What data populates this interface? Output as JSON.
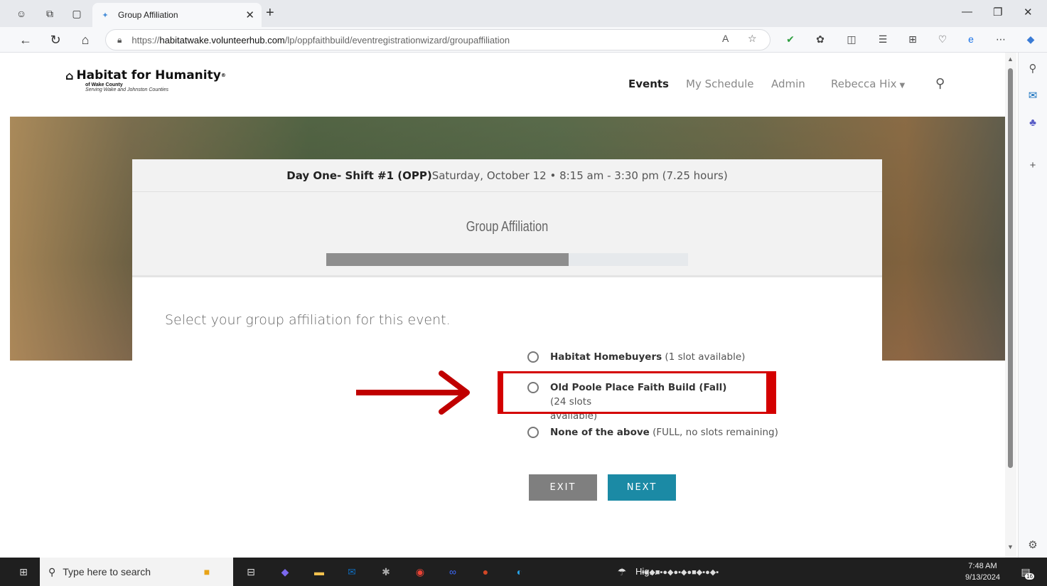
{
  "browser": {
    "tab_title": "Group Affiliation",
    "url_prefix": "https://",
    "url_domain": "habitatwake.volunteerhub.com",
    "url_path": "/lp/oppfaithbuild/eventregistrationwizard/groupaffiliation"
  },
  "site": {
    "logo_main": "Habitat for Humanity",
    "logo_reg": "®",
    "logo_sub1": "of Wake County",
    "logo_sub2": "Serving Wake and Johnston Counties",
    "nav": {
      "events": "Events",
      "my_schedule": "My Schedule",
      "admin": "Admin",
      "user": "Rebecca Hix"
    }
  },
  "event": {
    "name": "Day One- Shift #1 (OPP)",
    "datetime": "Saturday, October 12 • 8:15 am - 3:30 pm (7.25 hours)"
  },
  "wizard": {
    "title": "Group Affiliation",
    "progress": 0.67,
    "prompt": "Select your group affiliation for this event.",
    "options": [
      {
        "name": "Habitat Homebuyers",
        "detail": " (1 slot available)"
      },
      {
        "name": "Old Poole Place Faith Build (Fall)",
        "detail": " (24 slots",
        "detail2": "available)"
      },
      {
        "name": "None of the above",
        "detail": " (FULL, no slots remaining)"
      }
    ],
    "exit_label": "EXIT",
    "next_label": "NEXT"
  },
  "annotation": {
    "color": "#d40000"
  },
  "taskbar": {
    "search_placeholder": "Type here to search",
    "app_label": "Hig...",
    "time": "7:48 AM",
    "date": "9/13/2024",
    "notif_count": "16"
  },
  "colors": {
    "next_button": "#1b8aa5",
    "exit_button": "#7f7f7f",
    "progress_fill": "#8e8e8e"
  }
}
